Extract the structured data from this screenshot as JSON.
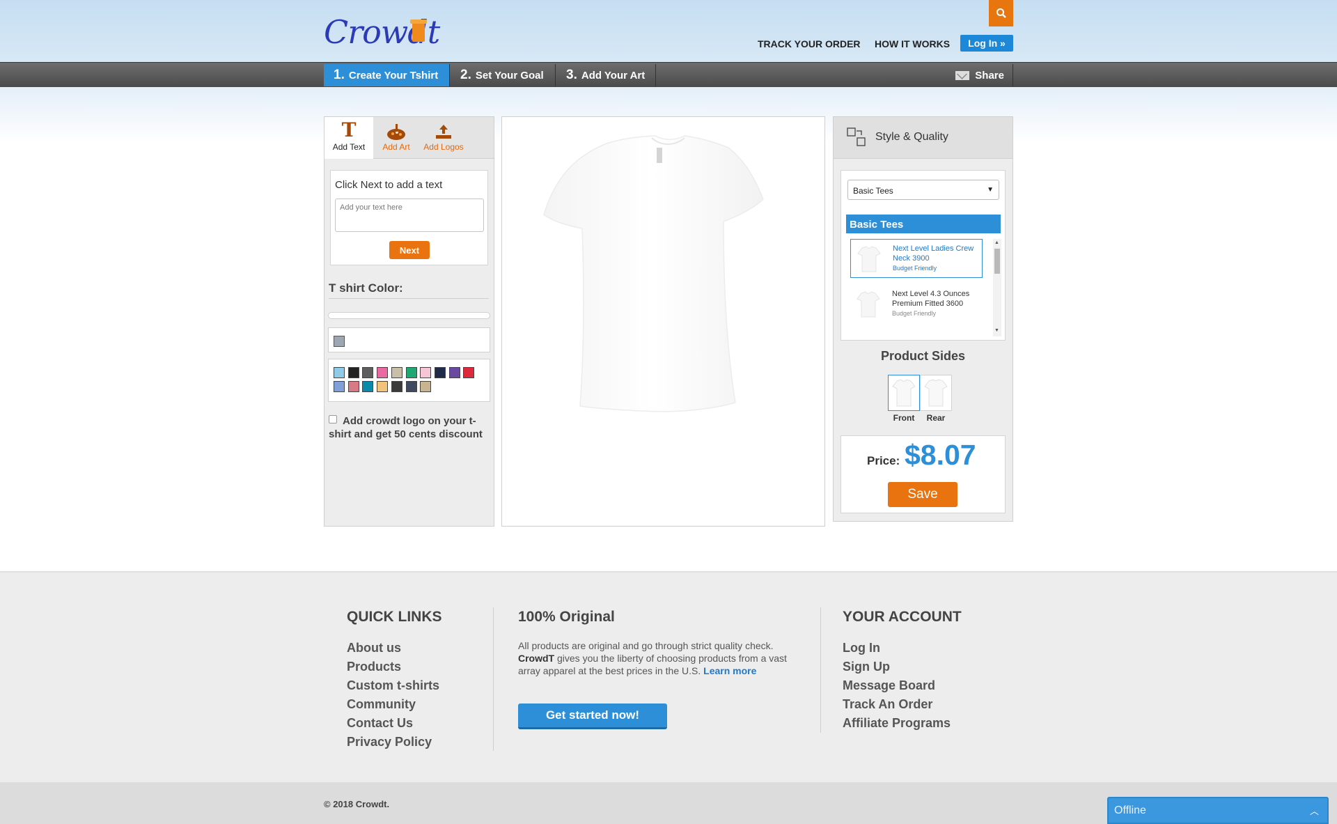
{
  "header": {
    "logo_text": "Crowdt",
    "search_icon": "search-icon",
    "links": [
      "TRACK YOUR ORDER",
      "HOW IT WORKS"
    ],
    "login_label": "Log In »"
  },
  "steps": [
    {
      "num": "1.",
      "label": "Create Your Tshirt"
    },
    {
      "num": "2.",
      "label": "Set Your Goal"
    },
    {
      "num": "3.",
      "label": "Add Your Art"
    }
  ],
  "share_label": "Share",
  "tools": {
    "tabs": [
      {
        "icon": "T",
        "label": "Add Text"
      },
      {
        "icon": "palette-icon",
        "label": "Add Art"
      },
      {
        "icon": "upload-icon",
        "label": "Add Logos"
      }
    ],
    "text_title": "Click Next to add a text",
    "text_placeholder": "Add your text here",
    "next_label": "Next",
    "color_title": "T shirt Color:",
    "selected_color": "#9da7b3",
    "palette": [
      "#8fcbe8",
      "#222222",
      "#5e5e5e",
      "#e96aa0",
      "#c9bfa8",
      "#1fa874",
      "#f7c6d6",
      "#1f2b48",
      "#6a4aa0",
      "#e0283c",
      "#7fa0d8",
      "#d87a86",
      "#0a8aaa",
      "#f2c37a",
      "#3a3a3a",
      "#3f4a60",
      "#c8b48e"
    ],
    "logo_checkbox_label": "Add crowdt logo on your t-shirt and get 50 cents discount"
  },
  "style": {
    "title": "Style & Quality",
    "select_value": "Basic Tees",
    "category": "Basic Tees",
    "products": [
      {
        "name": "Next Level Ladies Crew Neck 3900",
        "tag": "Budget Friendly"
      },
      {
        "name": "Next Level 4.3 Ounces Premium Fitted 3600",
        "tag": "Budget Friendly"
      }
    ],
    "sides_title": "Product Sides",
    "sides": [
      "Front",
      "Rear"
    ],
    "price_label": "Price:",
    "price_value": "$8.07",
    "save_label": "Save"
  },
  "footer": {
    "quick_links_title": "QUICK LINKS",
    "quick_links": [
      "About us",
      "Products",
      "Custom t-shirts",
      "Community",
      "Contact Us",
      "Privacy Policy"
    ],
    "original_title": "100% Original",
    "original_text_a": "All products are original and go through strict quality check.",
    "original_brand": "CrowdT",
    "original_text_b": "gives you the liberty of choosing products from a vast array apparel at the best prices in the U.S.",
    "learn_more": "Learn more",
    "cta_label": "Get started now!",
    "account_title": "YOUR ACCOUNT",
    "account_links": [
      "Log In",
      "Sign Up",
      "Message Board",
      "Track An Order",
      "Affiliate Programs"
    ],
    "copyright": "© 2018 Crowdt.",
    "chat_status": "Offline"
  }
}
